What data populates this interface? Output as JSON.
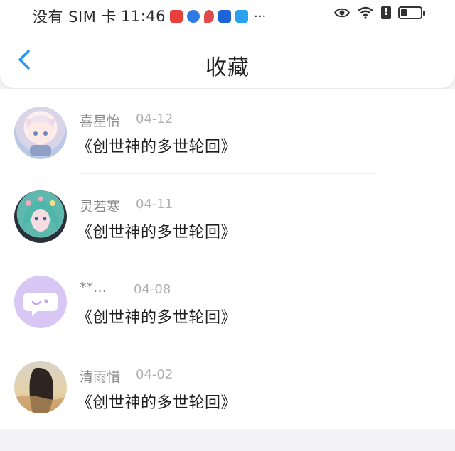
{
  "status_bar": {
    "carrier": "没有 SIM 卡",
    "time": "11:46",
    "more_indicator": "···",
    "alert_glyph": "!",
    "battery_level": 0.3,
    "icons": [
      "huawei-store-icon",
      "browser-icon",
      "red-app-icon",
      "tips-icon",
      "weather-icon",
      "eye-icon",
      "wifi-icon",
      "alert-icon",
      "battery-icon"
    ]
  },
  "header": {
    "title": "收藏",
    "back_icon": "chevron-left-icon",
    "accent_color": "#2196F3"
  },
  "favorites": [
    {
      "name": "喜星怡",
      "date": "04-12",
      "book": "《创世神的多世轮回》",
      "avatar": "anime-girl-avatar"
    },
    {
      "name": "灵若寒",
      "date": "04-11",
      "book": "《创世神的多世轮回》",
      "avatar": "flower-girl-avatar"
    },
    {
      "name": "**…",
      "date": "04-08",
      "book": "《创世神的多世轮回》",
      "avatar": "default-chat-avatar"
    },
    {
      "name": "清雨惜",
      "date": "04-02",
      "book": "《创世神的多世轮回》",
      "avatar": "beach-girl-avatar"
    }
  ]
}
